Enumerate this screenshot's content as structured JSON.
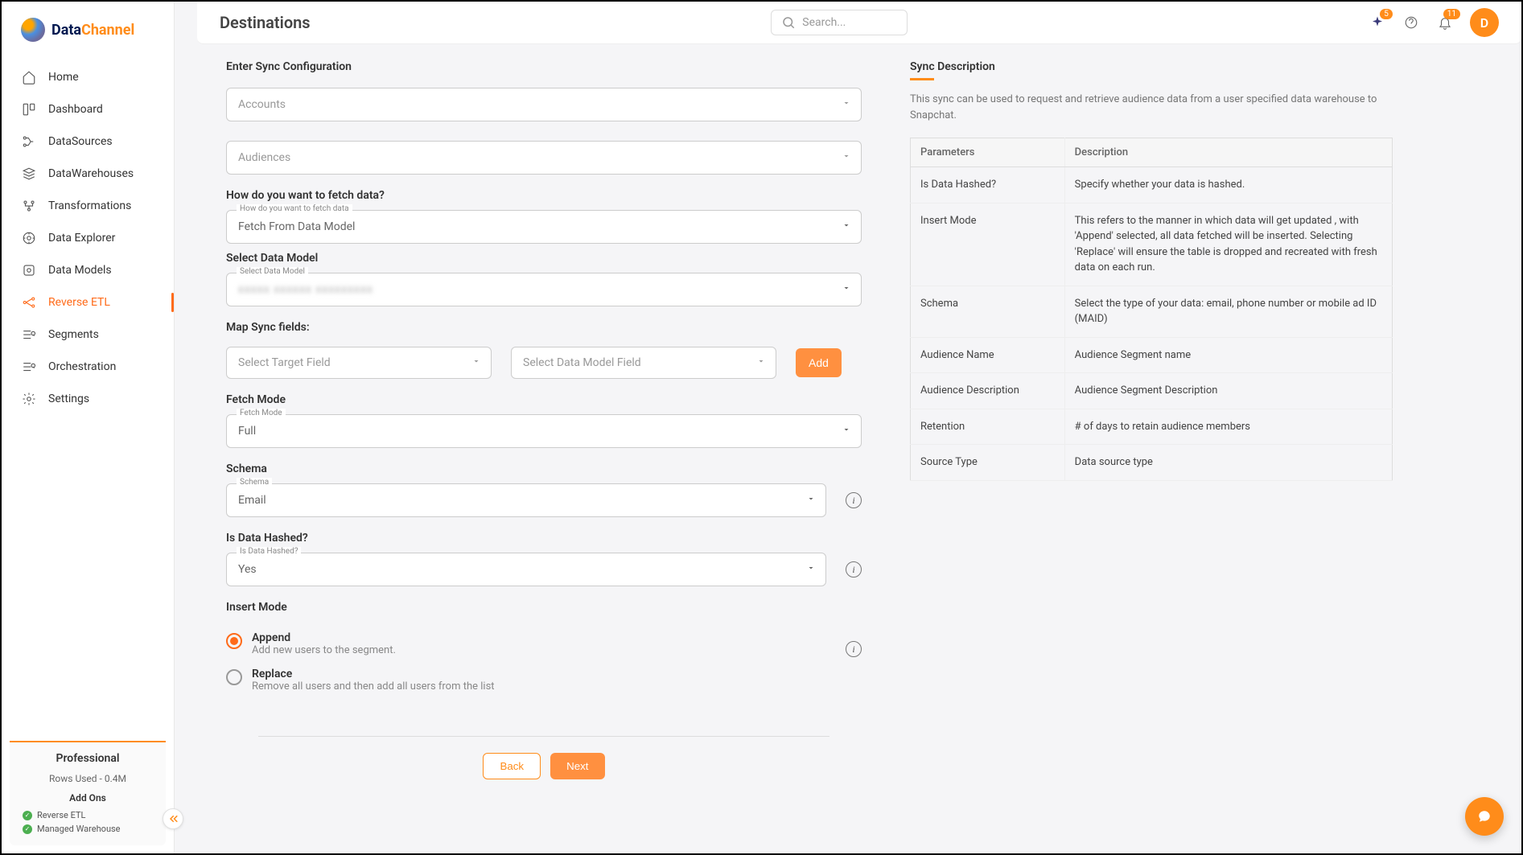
{
  "brand": {
    "part1": "Data",
    "part2": "Channel"
  },
  "sidebar": {
    "items": [
      {
        "label": "Home"
      },
      {
        "label": "Dashboard"
      },
      {
        "label": "DataSources"
      },
      {
        "label": "DataWarehouses"
      },
      {
        "label": "Transformations"
      },
      {
        "label": "Data Explorer"
      },
      {
        "label": "Data Models"
      },
      {
        "label": "Reverse ETL"
      },
      {
        "label": "Segments"
      },
      {
        "label": "Orchestration"
      },
      {
        "label": "Settings"
      }
    ],
    "plan": {
      "name": "Professional",
      "rows_used": "Rows Used - 0.4M",
      "addons_title": "Add Ons",
      "addons": [
        {
          "label": "Reverse ETL"
        },
        {
          "label": "Managed Warehouse"
        }
      ]
    }
  },
  "header": {
    "title": "Destinations",
    "search_placeholder": "Search...",
    "sparkle_badge": "5",
    "bell_badge": "11",
    "avatar_initial": "D"
  },
  "form": {
    "section_title": "Enter Sync Configuration",
    "accounts": {
      "placeholder": "Accounts"
    },
    "audiences": {
      "placeholder": "Audiences"
    },
    "fetch_question": "How do you want to fetch data?",
    "fetch_mode_select": {
      "floating": "How do you want to fetch data",
      "value": "Fetch From Data Model"
    },
    "select_data_model_label": "Select Data Model",
    "data_model_select": {
      "floating": "Select Data Model",
      "value": "xxxxx xxxxxx xxxxxxxxx"
    },
    "map_sync_label": "Map Sync fields:",
    "target_field": {
      "placeholder": "Select Target Field"
    },
    "data_model_field": {
      "placeholder": "Select Data Model Field"
    },
    "add_label": "Add",
    "fetch_mode_label": "Fetch Mode",
    "fetch_mode": {
      "floating": "Fetch Mode",
      "value": "Full"
    },
    "schema_label": "Schema",
    "schema": {
      "floating": "Schema",
      "value": "Email"
    },
    "hashed_label": "Is Data Hashed?",
    "hashed": {
      "floating": "Is Data Hashed?",
      "value": "Yes"
    },
    "insert_mode_label": "Insert Mode",
    "insert_options": [
      {
        "label": "Append",
        "desc": "Add new users to the segment."
      },
      {
        "label": "Replace",
        "desc": "Remove all users and then add all users from the list"
      }
    ],
    "back_label": "Back",
    "next_label": "Next"
  },
  "description": {
    "title": "Sync Description",
    "text": "This sync can be used to request and retrieve audience data from a user specified data warehouse to Snapchat.",
    "headers": {
      "param": "Parameters",
      "desc": "Description"
    },
    "rows": [
      {
        "param": "Is Data Hashed?",
        "desc": "Specify whether your data is hashed."
      },
      {
        "param": "Insert Mode",
        "desc": "This refers to the manner in which data will get updated , with 'Append' selected, all data fetched will be inserted. Selecting 'Replace' will ensure the table is dropped and recreated with fresh data on each run."
      },
      {
        "param": "Schema",
        "desc": "Select the type of your data: email, phone number or mobile ad ID (MAID)"
      },
      {
        "param": "Audience Name",
        "desc": "Audience Segment name"
      },
      {
        "param": "Audience Description",
        "desc": "Audience Segment Description"
      },
      {
        "param": "Retention",
        "desc": "# of days to retain audience members"
      },
      {
        "param": "Source Type",
        "desc": "Data source type"
      }
    ]
  }
}
